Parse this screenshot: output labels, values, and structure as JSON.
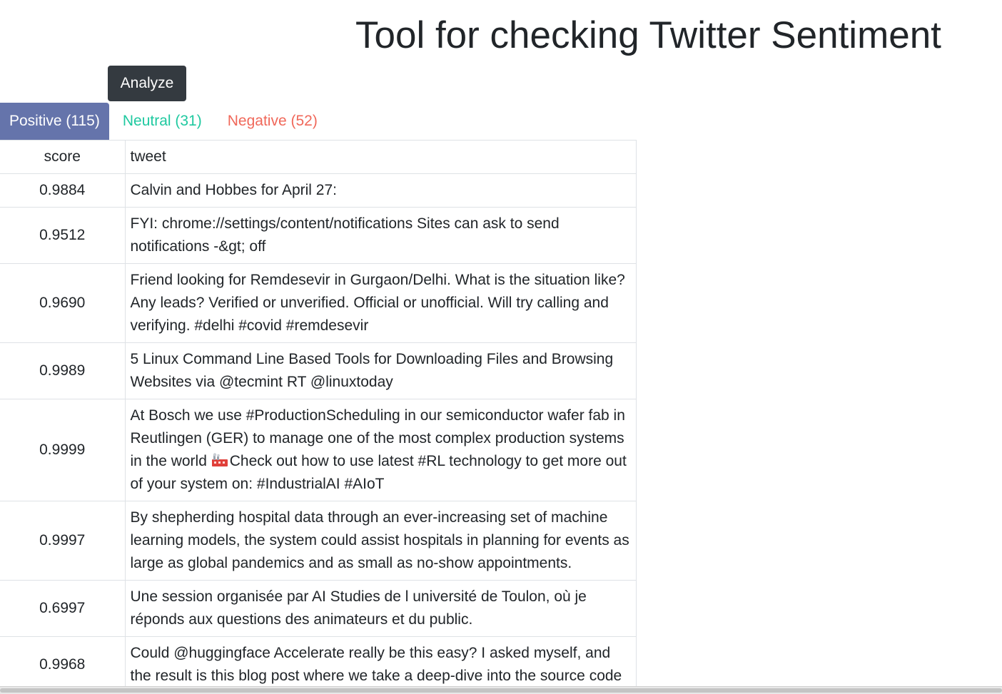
{
  "header": {
    "title": "Tool for checking Twitter Sentiment"
  },
  "actions": {
    "analyze_label": "Analyze"
  },
  "tabs": [
    {
      "label": "Positive",
      "count": "115",
      "active": true,
      "color": "#6574ab"
    },
    {
      "label": "Neutral",
      "count": "31",
      "active": false,
      "color": "#1fc9a0"
    },
    {
      "label": "Negative",
      "count": "52",
      "active": false,
      "color": "#f0685a"
    }
  ],
  "table": {
    "columns": [
      "score",
      "tweet"
    ],
    "rows": [
      {
        "score": "0.9884",
        "tweet": "Calvin and Hobbes for April 27:"
      },
      {
        "score": "0.9512",
        "tweet": "FYI: chrome://settings/content/notifications Sites can ask to send notifications -&gt; off"
      },
      {
        "score": "0.9690",
        "tweet": "Friend looking for Remdesevir in Gurgaon/Delhi. What is the situation like? Any leads? Verified or unverified. Official or unofficial. Will try calling and verifying. #delhi #covid #remdesevir"
      },
      {
        "score": "0.9989",
        "tweet": "5 Linux Command Line Based Tools for Downloading Files and Browsing Websites via @tecmint RT @linuxtoday"
      },
      {
        "score": "0.9999",
        "tweet_before": "At Bosch we use #ProductionScheduling in our semiconductor wafer fab in Reutlingen (GER) to manage one of the most complex production systems in the world ",
        "tweet_icon": "factory-emoji-icon",
        "tweet_after": "Check out how to use latest #RL technology to get more out of your system on: #IndustrialAI #AIoT"
      },
      {
        "score": "0.9997",
        "tweet": "By shepherding hospital data through an ever-increasing set of machine learning models, the system could assist hospitals in planning for events as large as global pandemics and as small as no-show appointments."
      },
      {
        "score": "0.6997",
        "tweet": "Une session organisée par AI Studies de l université de Toulon, où je réponds aux questions des animateurs et du public."
      },
      {
        "score": "0.9968",
        "tweet": "Could @huggingface Accelerate really be this easy? I asked myself, and the result is this blog post where we take a deep-dive into the source code"
      }
    ]
  }
}
